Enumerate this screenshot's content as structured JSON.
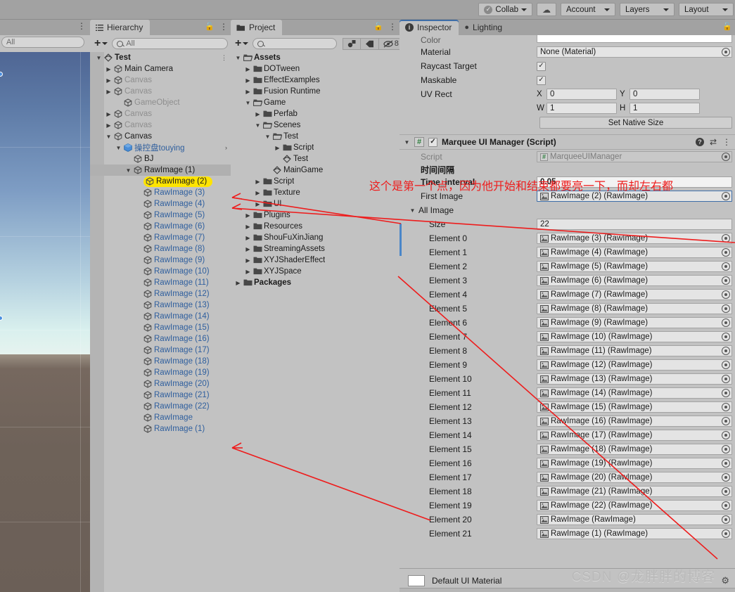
{
  "toolbar": {
    "collab_label": "Collab",
    "cloud_icon": "cloud-icon",
    "account_label": "Account",
    "layers_label": "Layers",
    "layout_label": "Layout"
  },
  "scene_panel": {
    "search_value": "All",
    "kebab": "⋮"
  },
  "hierarchy": {
    "tab_label": "Hierarchy",
    "search_placeholder": "All",
    "plus_label": "+",
    "rows": [
      {
        "label": "Test",
        "indent": 0,
        "twirl": "open",
        "icon": "scene-icon",
        "style": "bold"
      },
      {
        "label": "Main Camera",
        "indent": 1,
        "twirl": "closed",
        "icon": "gameobject-icon",
        "style": "normal"
      },
      {
        "label": "Canvas",
        "indent": 1,
        "twirl": "closed",
        "icon": "gameobject-icon",
        "style": "dim"
      },
      {
        "label": "Canvas",
        "indent": 1,
        "twirl": "closed",
        "icon": "gameobject-icon",
        "style": "dim"
      },
      {
        "label": "GameObject",
        "indent": 2,
        "twirl": "none",
        "icon": "gameobject-icon",
        "style": "dim"
      },
      {
        "label": "Canvas",
        "indent": 1,
        "twirl": "closed",
        "icon": "gameobject-icon",
        "style": "dim"
      },
      {
        "label": "Canvas",
        "indent": 1,
        "twirl": "closed",
        "icon": "gameobject-icon",
        "style": "dim"
      },
      {
        "label": "Canvas",
        "indent": 1,
        "twirl": "open",
        "icon": "gameobject-icon",
        "style": "normal"
      },
      {
        "label": "操控盘touying",
        "indent": 2,
        "twirl": "open",
        "icon": "prefab-icon",
        "style": "prefab"
      },
      {
        "label": "BJ",
        "indent": 3,
        "twirl": "none",
        "icon": "gameobject-icon",
        "style": "normal"
      },
      {
        "label": "RawImage (1)",
        "indent": 3,
        "twirl": "open",
        "icon": "gameobject-icon",
        "style": "selected"
      },
      {
        "label": "RawImage (2)",
        "indent": 4,
        "twirl": "none",
        "icon": "gameobject-icon",
        "style": "highlight"
      },
      {
        "label": "RawImage (3)",
        "indent": 4,
        "twirl": "none",
        "icon": "gameobject-icon",
        "style": "blue"
      },
      {
        "label": "RawImage (4)",
        "indent": 4,
        "twirl": "none",
        "icon": "gameobject-icon",
        "style": "blue"
      },
      {
        "label": "RawImage (5)",
        "indent": 4,
        "twirl": "none",
        "icon": "gameobject-icon",
        "style": "blue"
      },
      {
        "label": "RawImage (6)",
        "indent": 4,
        "twirl": "none",
        "icon": "gameobject-icon",
        "style": "blue"
      },
      {
        "label": "RawImage (7)",
        "indent": 4,
        "twirl": "none",
        "icon": "gameobject-icon",
        "style": "blue"
      },
      {
        "label": "RawImage (8)",
        "indent": 4,
        "twirl": "none",
        "icon": "gameobject-icon",
        "style": "blue"
      },
      {
        "label": "RawImage (9)",
        "indent": 4,
        "twirl": "none",
        "icon": "gameobject-icon",
        "style": "blue"
      },
      {
        "label": "RawImage (10)",
        "indent": 4,
        "twirl": "none",
        "icon": "gameobject-icon",
        "style": "blue"
      },
      {
        "label": "RawImage (11)",
        "indent": 4,
        "twirl": "none",
        "icon": "gameobject-icon",
        "style": "blue"
      },
      {
        "label": "RawImage (12)",
        "indent": 4,
        "twirl": "none",
        "icon": "gameobject-icon",
        "style": "blue"
      },
      {
        "label": "RawImage (13)",
        "indent": 4,
        "twirl": "none",
        "icon": "gameobject-icon",
        "style": "blue"
      },
      {
        "label": "RawImage (14)",
        "indent": 4,
        "twirl": "none",
        "icon": "gameobject-icon",
        "style": "blue"
      },
      {
        "label": "RawImage (15)",
        "indent": 4,
        "twirl": "none",
        "icon": "gameobject-icon",
        "style": "blue"
      },
      {
        "label": "RawImage (16)",
        "indent": 4,
        "twirl": "none",
        "icon": "gameobject-icon",
        "style": "blue"
      },
      {
        "label": "RawImage (17)",
        "indent": 4,
        "twirl": "none",
        "icon": "gameobject-icon",
        "style": "blue"
      },
      {
        "label": "RawImage (18)",
        "indent": 4,
        "twirl": "none",
        "icon": "gameobject-icon",
        "style": "blue"
      },
      {
        "label": "RawImage (19)",
        "indent": 4,
        "twirl": "none",
        "icon": "gameobject-icon",
        "style": "blue"
      },
      {
        "label": "RawImage (20)",
        "indent": 4,
        "twirl": "none",
        "icon": "gameobject-icon",
        "style": "blue"
      },
      {
        "label": "RawImage (21)",
        "indent": 4,
        "twirl": "none",
        "icon": "gameobject-icon",
        "style": "blue"
      },
      {
        "label": "RawImage (22)",
        "indent": 4,
        "twirl": "none",
        "icon": "gameobject-icon",
        "style": "blue"
      },
      {
        "label": "RawImage",
        "indent": 4,
        "twirl": "none",
        "icon": "gameobject-icon",
        "style": "blue"
      },
      {
        "label": "RawImage (1)",
        "indent": 4,
        "twirl": "none",
        "icon": "gameobject-icon",
        "style": "blue"
      }
    ]
  },
  "project": {
    "tab_label": "Project",
    "search_placeholder": "",
    "hidden_count": "8",
    "rows": [
      {
        "label": "Assets",
        "indent": 0,
        "twirl": "open",
        "icon": "folder-open-icon",
        "style": "bold"
      },
      {
        "label": "DOTween",
        "indent": 1,
        "twirl": "closed",
        "icon": "folder-icon",
        "style": "normal"
      },
      {
        "label": "EffectExamples",
        "indent": 1,
        "twirl": "closed",
        "icon": "folder-icon",
        "style": "normal"
      },
      {
        "label": "Fusion Runtime",
        "indent": 1,
        "twirl": "closed",
        "icon": "folder-icon",
        "style": "normal"
      },
      {
        "label": "Game",
        "indent": 1,
        "twirl": "open",
        "icon": "folder-open-icon",
        "style": "normal"
      },
      {
        "label": "Perfab",
        "indent": 2,
        "twirl": "closed",
        "icon": "folder-icon",
        "style": "normal"
      },
      {
        "label": "Scenes",
        "indent": 2,
        "twirl": "open",
        "icon": "folder-open-icon",
        "style": "normal"
      },
      {
        "label": "Test",
        "indent": 3,
        "twirl": "open",
        "icon": "folder-open-icon",
        "style": "normal"
      },
      {
        "label": "Script",
        "indent": 4,
        "twirl": "closed",
        "icon": "folder-icon",
        "style": "normal"
      },
      {
        "label": "Test",
        "indent": 4,
        "twirl": "none",
        "icon": "scene-icon",
        "style": "normal"
      },
      {
        "label": "MainGame",
        "indent": 3,
        "twirl": "none",
        "icon": "scene-icon",
        "style": "normal"
      },
      {
        "label": "Script",
        "indent": 2,
        "twirl": "closed",
        "icon": "folder-icon",
        "style": "normal"
      },
      {
        "label": "Texture",
        "indent": 2,
        "twirl": "closed",
        "icon": "folder-icon",
        "style": "normal"
      },
      {
        "label": "UI",
        "indent": 2,
        "twirl": "closed",
        "icon": "folder-icon",
        "style": "normal"
      },
      {
        "label": "Plugins",
        "indent": 1,
        "twirl": "closed",
        "icon": "folder-icon",
        "style": "normal"
      },
      {
        "label": "Resources",
        "indent": 1,
        "twirl": "closed",
        "icon": "folder-icon",
        "style": "normal"
      },
      {
        "label": "ShouFuXinJiang",
        "indent": 1,
        "twirl": "closed",
        "icon": "folder-icon",
        "style": "normal"
      },
      {
        "label": "StreamingAssets",
        "indent": 1,
        "twirl": "closed",
        "icon": "folder-icon",
        "style": "normal"
      },
      {
        "label": "XYJShaderEffect",
        "indent": 1,
        "twirl": "closed",
        "icon": "folder-icon",
        "style": "normal"
      },
      {
        "label": "XYJSpace",
        "indent": 1,
        "twirl": "closed",
        "icon": "folder-icon",
        "style": "normal"
      },
      {
        "label": "Packages",
        "indent": 0,
        "twirl": "closed",
        "icon": "folder-icon",
        "style": "bold"
      }
    ]
  },
  "inspector": {
    "tab_label": "Inspector",
    "lighting_tab_label": "Lighting",
    "raw_image": {
      "color_label": "Color",
      "color_value": "",
      "material_label": "Material",
      "material_value": "None (Material)",
      "raycast_label": "Raycast Target",
      "raycast_checked": "✓",
      "maskable_label": "Maskable",
      "maskable_checked": "✓",
      "uvrect_label": "UV Rect",
      "x_label": "X",
      "x_value": "0",
      "y_label": "Y",
      "y_value": "0",
      "w_label": "W",
      "w_value": "1",
      "h_label": "H",
      "h_value": "1",
      "set_native_size_label": "Set Native Size"
    },
    "component": {
      "title": "Marquee UI Manager (Script)",
      "script_label": "Script",
      "script_value": "MarqueeUIManager",
      "tooltip_cn": "时间间隔",
      "time_interval_label": "Time_interval",
      "time_interval_value": "0.05",
      "first_image_label": "First Image",
      "first_image_value": "RawImage (2) (RawImage)",
      "all_image_label": "All Image",
      "size_label": "Size",
      "size_value": "22",
      "elements": [
        {
          "label": "Element 0",
          "value": "RawImage (3) (RawImage)"
        },
        {
          "label": "Element 1",
          "value": "RawImage (4) (RawImage)"
        },
        {
          "label": "Element 2",
          "value": "RawImage (5) (RawImage)"
        },
        {
          "label": "Element 3",
          "value": "RawImage (6) (RawImage)"
        },
        {
          "label": "Element 4",
          "value": "RawImage (7) (RawImage)"
        },
        {
          "label": "Element 5",
          "value": "RawImage (8) (RawImage)"
        },
        {
          "label": "Element 6",
          "value": "RawImage (9) (RawImage)"
        },
        {
          "label": "Element 7",
          "value": "RawImage (10) (RawImage)"
        },
        {
          "label": "Element 8",
          "value": "RawImage (11) (RawImage)"
        },
        {
          "label": "Element 9",
          "value": "RawImage (12) (RawImage)"
        },
        {
          "label": "Element 10",
          "value": "RawImage (13) (RawImage)"
        },
        {
          "label": "Element 11",
          "value": "RawImage (14) (RawImage)"
        },
        {
          "label": "Element 12",
          "value": "RawImage (15) (RawImage)"
        },
        {
          "label": "Element 13",
          "value": "RawImage (16) (RawImage)"
        },
        {
          "label": "Element 14",
          "value": "RawImage (17) (RawImage)"
        },
        {
          "label": "Element 15",
          "value": "RawImage (18) (RawImage)"
        },
        {
          "label": "Element 16",
          "value": "RawImage (19) (RawImage)"
        },
        {
          "label": "Element 17",
          "value": "RawImage (20) (RawImage)"
        },
        {
          "label": "Element 18",
          "value": "RawImage (21) (RawImage)"
        },
        {
          "label": "Element 19",
          "value": "RawImage (22) (RawImage)"
        },
        {
          "label": "Element 20",
          "value": "RawImage (RawImage)"
        },
        {
          "label": "Element 21",
          "value": "RawImage (1) (RawImage)"
        }
      ]
    },
    "material_footer": {
      "name": "Default UI Material"
    }
  },
  "annotation": {
    "red_text": "这个是第一个点，因为他开始和结束都要亮一下，而却左右都",
    "color": "#ee1c1c"
  },
  "watermark": {
    "text": "CSDN @龙胖胖的博客"
  }
}
